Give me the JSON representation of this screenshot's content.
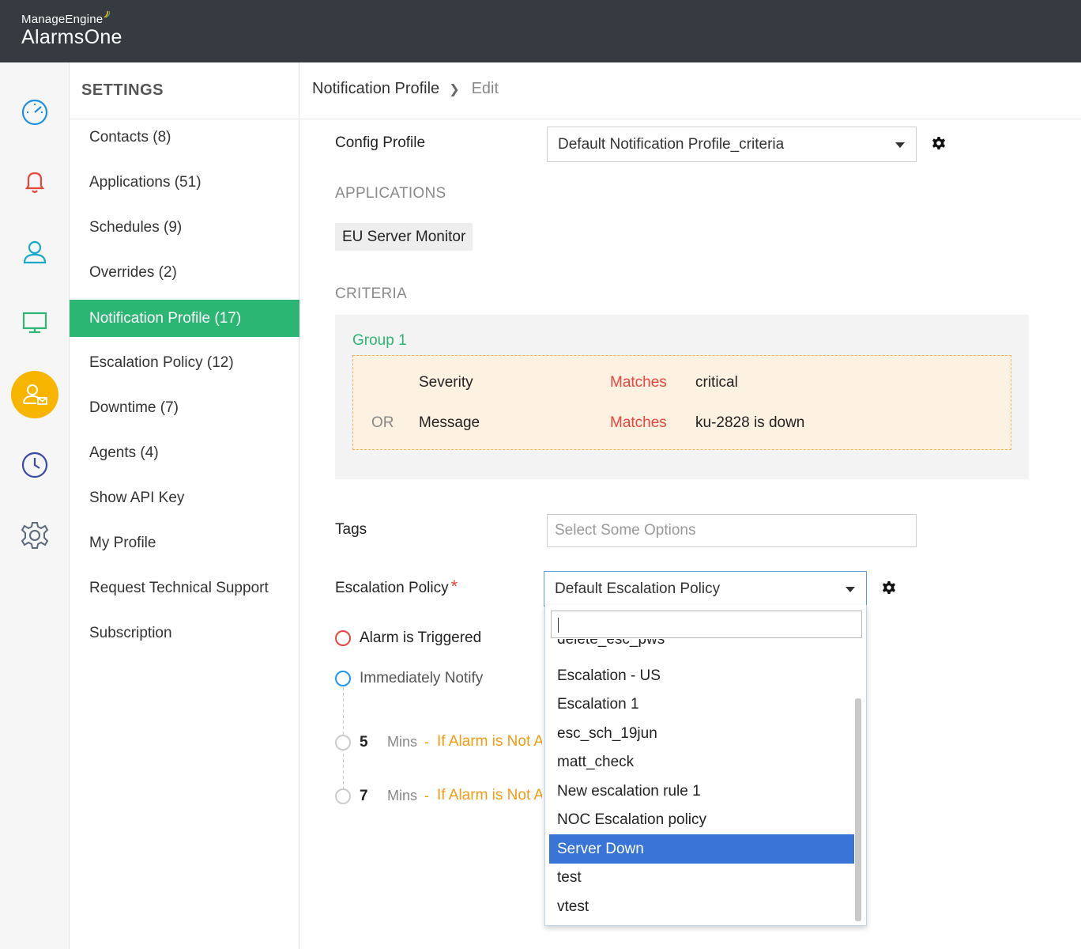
{
  "app": {
    "vendor": "ManageEngine",
    "product": "AlarmsOne"
  },
  "rail": {
    "items": [
      "dashboard-icon",
      "alarm-bell-icon",
      "user-icon",
      "monitor-icon",
      "user-notification-icon",
      "clock-icon",
      "gear-icon"
    ],
    "active": "user-notification-icon",
    "active_color": "#f7b500"
  },
  "settings": {
    "title": "SETTINGS",
    "items": [
      {
        "label": "Contacts (8)"
      },
      {
        "label": "Applications (51)"
      },
      {
        "label": "Schedules (9)"
      },
      {
        "label": "Overrides (2)"
      },
      {
        "label": "Notification Profile (17)",
        "active": true
      },
      {
        "label": "Escalation Policy (12)"
      },
      {
        "label": "Downtime (7)"
      },
      {
        "label": "Agents (4)"
      },
      {
        "label": "Show API Key"
      },
      {
        "label": "My Profile"
      },
      {
        "label": "Request Technical Support"
      },
      {
        "label": "Subscription"
      }
    ]
  },
  "breadcrumb": {
    "parent": "Notification Profile",
    "current": "Edit"
  },
  "form": {
    "config_profile": {
      "label": "Config Profile",
      "value": "Default Notification Profile_criteria"
    },
    "applications": {
      "title": "APPLICATIONS",
      "chips": [
        "EU Server Monitor"
      ]
    },
    "criteria": {
      "title": "CRITERIA",
      "group_title": "Group 1",
      "rows": [
        {
          "op": "",
          "field": "Severity",
          "match": "Matches",
          "value": "critical"
        },
        {
          "op": "OR",
          "field": "Message",
          "match": "Matches",
          "value": "ku-2828 is down"
        }
      ]
    },
    "tags": {
      "label": "Tags",
      "placeholder": "Select Some Options"
    },
    "escalation": {
      "label": "Escalation Policy",
      "required": "*",
      "value": "Default Escalation Policy"
    }
  },
  "timeline": {
    "triggered": "Alarm is Triggered",
    "notify": "Immediately Notify",
    "steps": [
      {
        "num": "5",
        "unit": "Mins",
        "dash": "-",
        "cond": "If Alarm is Not Acknowledged"
      },
      {
        "num": "7",
        "unit": "Mins",
        "dash": "-",
        "cond": "If Alarm is Not Acknowledged"
      }
    ]
  },
  "dropdown": {
    "search_value": "",
    "options": [
      "delete_esc_pws",
      "Escalation - US",
      "Escalation 1",
      "esc_sch_19jun",
      "matt_check",
      "New escalation rule 1",
      "NOC Escalation policy",
      "Server Down",
      "test",
      "vtest"
    ],
    "highlighted": "Server Down"
  },
  "colors": {
    "topbar": "#363b42",
    "active_green": "#2bb673",
    "match_red": "#e8453c",
    "warning_orange": "#f39c12",
    "highlight_blue": "#3875d7"
  }
}
